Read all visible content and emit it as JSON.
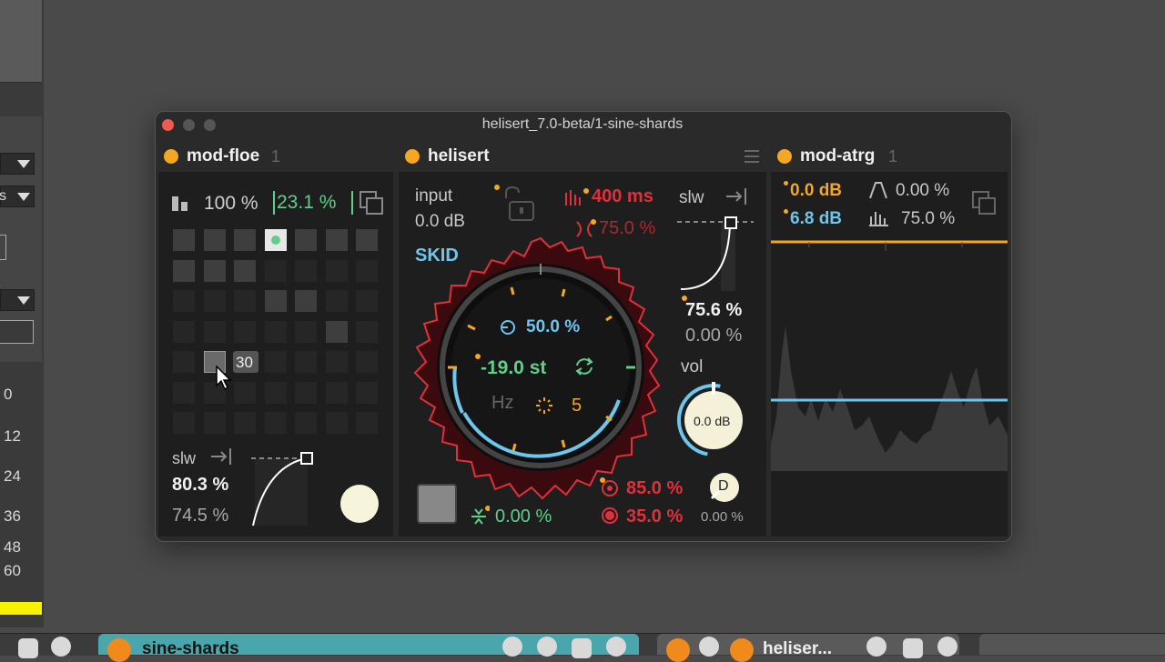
{
  "window": {
    "title": "helisert_7.0-beta/1-sine-shards"
  },
  "left_sidebar": {
    "dropdown_1": "s",
    "numbers": [
      "0",
      "12",
      "24",
      "36",
      "48",
      "60"
    ]
  },
  "bottom_bar": {
    "clip_tab_label": "sine-shards",
    "device_tab_label": "heliser..."
  },
  "mod_floe": {
    "title": "mod-floe",
    "number": "1",
    "depth_value": "100 %",
    "amount_value": "23.1 %",
    "tooltip_value": "30",
    "slw_label": "slw",
    "slw_value": "80.3 %",
    "second_value": "74.5 %",
    "grid": [
      [
        2,
        2,
        2,
        3,
        2,
        2,
        2
      ],
      [
        2,
        2,
        2,
        1,
        1,
        1,
        1
      ],
      [
        1,
        1,
        1,
        2,
        2,
        1,
        1
      ],
      [
        1,
        1,
        1,
        1,
        1,
        2,
        1
      ],
      [
        1,
        4,
        0,
        1,
        1,
        1,
        1
      ],
      [
        1,
        1,
        1,
        1,
        1,
        1,
        1
      ],
      [
        1,
        1,
        1,
        1,
        1,
        1,
        1
      ]
    ]
  },
  "helisert": {
    "title": "helisert",
    "input_label": "input",
    "input_value": "0.0 dB",
    "mode_label": "SKID",
    "time_value": "400 ms",
    "cross_value": "75.0 %",
    "slw_label": "slw",
    "slw_value": "75.6 %",
    "slw_value_2": "0.00 %",
    "vol_label": "vol",
    "vol_value": "0.0 dB",
    "dial_percent": "50.0 %",
    "pitch_value": "-19.0 st",
    "hz_label": "Hz",
    "voices_value": "5",
    "spread_value": "0.00 %",
    "feedback_value": "85.0 %",
    "mix_value": "35.0 %",
    "d_label": "D",
    "d_value": "0.00 %"
  },
  "mod_atrg": {
    "title": "mod-atrg",
    "number": "1",
    "threshold_value": "0.0 dB",
    "attack_value": "0.00 %",
    "level_value": "6.8 dB",
    "release_value": "75.0 %"
  },
  "colors": {
    "accent_orange": "#f5a623",
    "accent_green": "#5fcf8a",
    "accent_red": "#e0303a",
    "accent_blue": "#6cc6ee",
    "clip_teal": "#49a6ac"
  }
}
